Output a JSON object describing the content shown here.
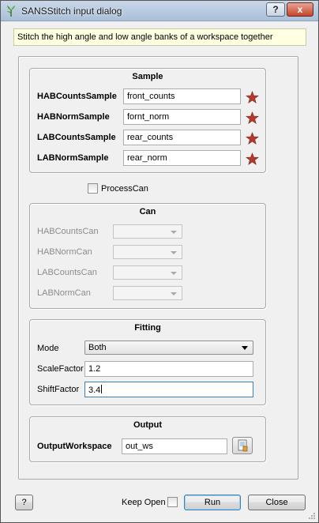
{
  "window": {
    "title": "SANSStitch input dialog",
    "help_button": "?",
    "close_button": "x"
  },
  "description": "Stitch the high angle and low angle banks of a workspace together",
  "sample": {
    "title": "Sample",
    "rows": [
      {
        "label": "HABCountsSample",
        "value": "front_counts"
      },
      {
        "label": "HABNormSample",
        "value": "fornt_norm"
      },
      {
        "label": "LABCountsSample",
        "value": "rear_counts"
      },
      {
        "label": "LABNormSample",
        "value": "rear_norm"
      }
    ]
  },
  "process_can": {
    "label": "ProcessCan",
    "checked": false
  },
  "can": {
    "title": "Can",
    "rows": [
      {
        "label": "HABCountsCan",
        "value": ""
      },
      {
        "label": "HABNormCan",
        "value": ""
      },
      {
        "label": "LABCountsCan",
        "value": ""
      },
      {
        "label": "LABNormCan",
        "value": ""
      }
    ]
  },
  "fitting": {
    "title": "Fitting",
    "mode_label": "Mode",
    "mode_value": "Both",
    "scale_label": "ScaleFactor",
    "scale_value": "1.2",
    "shift_label": "ShiftFactor",
    "shift_value": "3.4"
  },
  "output": {
    "title": "Output",
    "workspace_label": "OutputWorkspace",
    "workspace_value": "out_ws"
  },
  "footer": {
    "help_button": "?",
    "keep_open_label": "Keep Open",
    "keep_open_checked": false,
    "run_button": "Run",
    "close_button": "Close"
  },
  "colors": {
    "required_star": "#b03a2e",
    "description_bg": "#ffffe1",
    "focus_border": "#3c7fb1"
  }
}
